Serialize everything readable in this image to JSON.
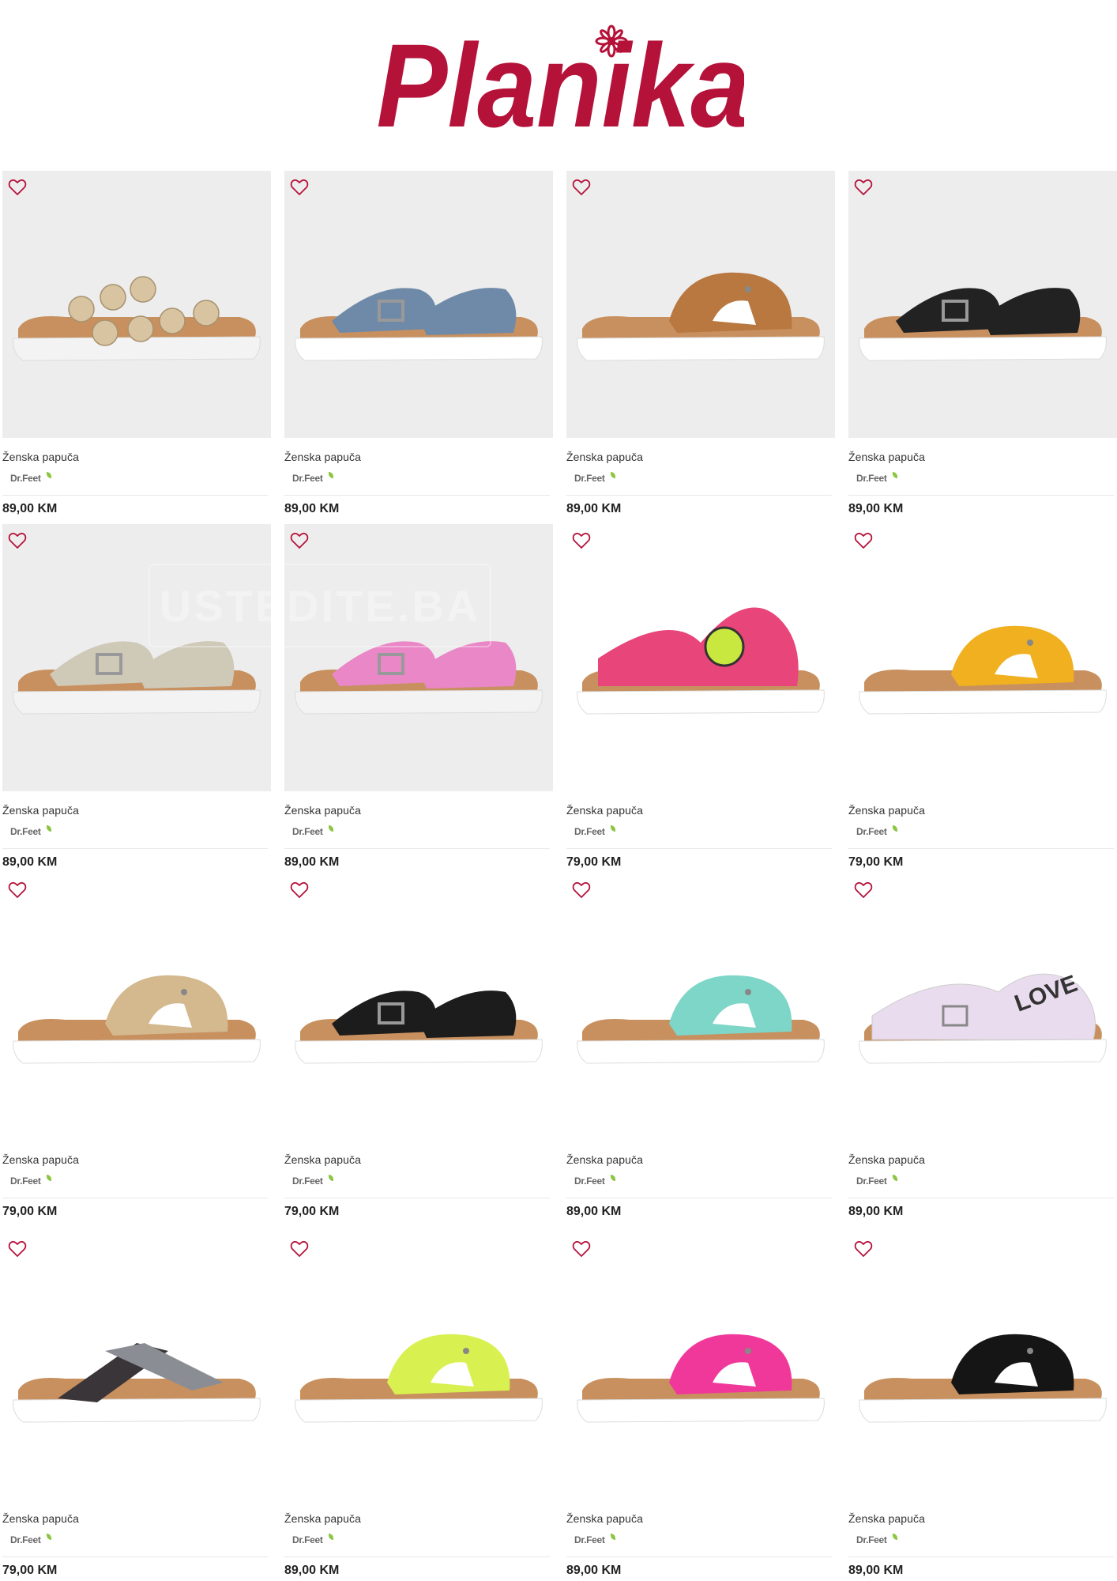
{
  "brand": {
    "logo_text": "Planika",
    "logo_color": "#b5123a"
  },
  "watermark": "USTEDITE.BA",
  "products": [
    {
      "title": "Ženska papuča",
      "brand": "Dr.Feet",
      "price": "89,00 KM",
      "bg": "gray",
      "shoe": "gold",
      "colors": [
        "#d8c4a0",
        "#c9b48a"
      ]
    },
    {
      "title": "Ženska papuča",
      "brand": "Dr.Feet",
      "price": "89,00 KM",
      "bg": "gray",
      "shoe": "blue",
      "colors": [
        "#6e8aa8",
        "#c08a5a"
      ]
    },
    {
      "title": "Ženska papuča",
      "brand": "Dr.Feet",
      "price": "89,00 KM",
      "bg": "gray",
      "shoe": "brown",
      "colors": [
        "#b87840",
        "#c08a5a"
      ]
    },
    {
      "title": "Ženska papuča",
      "brand": "Dr.Feet",
      "price": "89,00 KM",
      "bg": "gray",
      "shoe": "black",
      "colors": [
        "#222222",
        "#8a6a4e"
      ]
    },
    {
      "title": "Ženska papuča",
      "brand": "Dr.Feet",
      "price": "89,00 KM",
      "bg": "gray",
      "shoe": "silver",
      "colors": [
        "#cfc9b8",
        "#9c7a5c"
      ]
    },
    {
      "title": "Ženska papuča",
      "brand": "Dr.Feet",
      "price": "89,00 KM",
      "bg": "gray",
      "shoe": "pink",
      "colors": [
        "#e987c7",
        "#f0a8d4"
      ]
    },
    {
      "title": "Ženska papuča",
      "brand": "Dr.Feet",
      "price": "79,00 KM",
      "bg": "white",
      "shoe": "print",
      "colors": [
        "#e8457a",
        "#f2d2b0"
      ]
    },
    {
      "title": "Ženska papuča",
      "brand": "Dr.Feet",
      "price": "79,00 KM",
      "bg": "white",
      "shoe": "yellow",
      "colors": [
        "#f0b020",
        "#d6a26a"
      ]
    },
    {
      "title": "Ženska papuča",
      "brand": "Dr.Feet",
      "price": "79,00 KM",
      "bg": "white",
      "shoe": "beige",
      "colors": [
        "#d4b88e",
        "#d6a26a"
      ]
    },
    {
      "title": "Ženska papuča",
      "brand": "Dr.Feet",
      "price": "79,00 KM",
      "bg": "white",
      "shoe": "blackglitter",
      "colors": [
        "#1c1c1c",
        "#1c1c1c"
      ]
    },
    {
      "title": "Ženska papuča",
      "brand": "Dr.Feet",
      "price": "89,00 KM",
      "bg": "white",
      "shoe": "mint",
      "colors": [
        "#7ed6c8",
        "#d6c8a8"
      ]
    },
    {
      "title": "Ženska papuča",
      "brand": "Dr.Feet",
      "price": "89,00 KM",
      "bg": "white",
      "shoe": "lilac",
      "colors": [
        "#eadcef",
        "#e6d6ea"
      ]
    },
    {
      "title": "Ženska papuča",
      "brand": "Dr.Feet",
      "price": "79,00 KM",
      "bg": "white",
      "shoe": "metallic",
      "colors": [
        "#8a8e94",
        "#c8b898"
      ]
    },
    {
      "title": "Ženska papuča",
      "brand": "Dr.Feet",
      "price": "89,00 KM",
      "bg": "white",
      "shoe": "lime",
      "colors": [
        "#d8f050",
        "#d6c8a8"
      ]
    },
    {
      "title": "Ženska papuča",
      "brand": "Dr.Feet",
      "price": "89,00 KM",
      "bg": "white",
      "shoe": "fuchsia",
      "colors": [
        "#f0389a",
        "#d6c8a8"
      ]
    },
    {
      "title": "Ženska papuča",
      "brand": "Dr.Feet",
      "price": "89,00 KM",
      "bg": "white",
      "shoe": "blackleather",
      "colors": [
        "#151515",
        "#d6c8a8"
      ]
    }
  ]
}
